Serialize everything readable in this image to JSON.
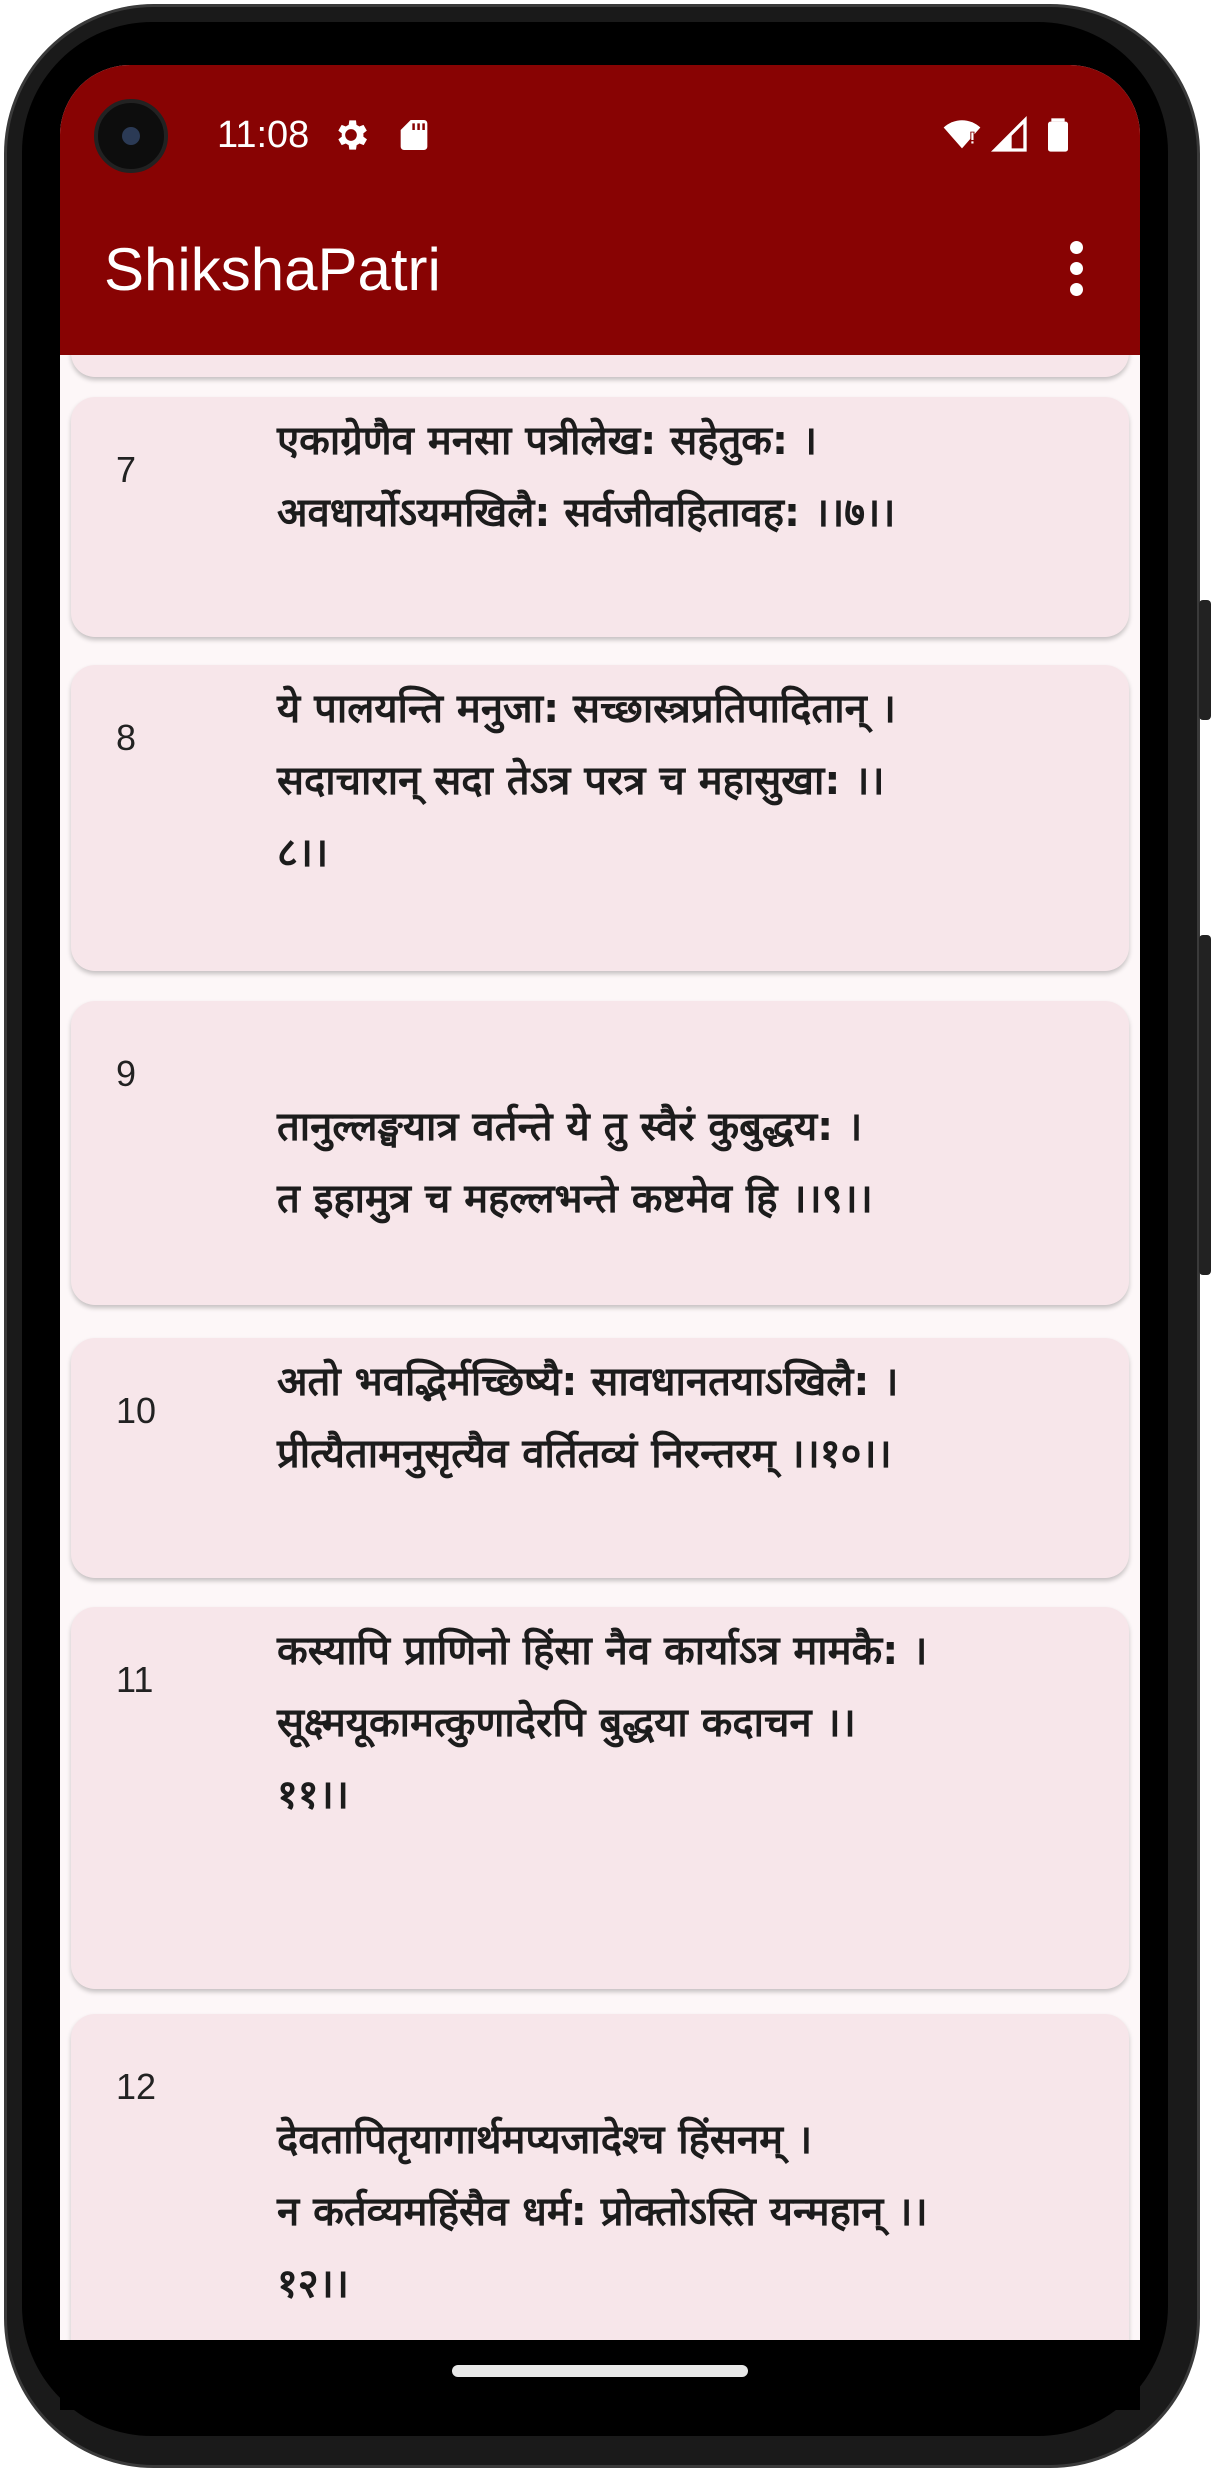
{
  "status_bar": {
    "time": "11:08",
    "icons": [
      "settings-gear-icon",
      "sd-card-icon",
      "wifi-icon",
      "signal-icon",
      "battery-icon"
    ]
  },
  "app_bar": {
    "title": "ShikshaPatri",
    "menu_icon": "more-vert-icon",
    "color": "#880303"
  },
  "colors": {
    "card_background": "#f7e6ea",
    "screen_background": "#fdf7f8"
  },
  "verses": [
    {
      "number": "7",
      "lines": [
        "एकाग्रेणैव मनसा पत्रीलेख: सहेतुक: ।",
        "अवधार्योऽयमखिलै: सर्वजीवहितावह: ।।७।।"
      ]
    },
    {
      "number": "8",
      "lines": [
        "ये पालयन्ति मनुजा: सच्छास्त्रप्रतिपादितान् ।",
        "सदाचारान् सदा तेऽत्र परत्र  च  महासुखा: ।।",
        "८।।"
      ]
    },
    {
      "number": "9",
      "lines": [
        "तानुल्लङ्घयात्र वर्तन्ते ये तु स्वैरं कुबुद्धय: ।",
        "त इहामुत्र च महल्लभन्ते कष्टमेव हि ।।९।।"
      ]
    },
    {
      "number": "10",
      "lines": [
        "अतो भवद्भिर्मच्छिष्यै: सावधानतयाऽखिलै: ।",
        "प्रीत्यैतामनुसृत्यैव वर्तितव्यं निरन्तरम् ।।१०।।"
      ]
    },
    {
      "number": "11",
      "lines": [
        "कस्यापि प्राणिनो हिंसा नैव कार्याऽत्र मामकै: ।",
        "सूक्ष्मयूकामत्कुणादेरपि बुद्धया कदाचन ।।",
        "११।।"
      ]
    },
    {
      "number": "12",
      "lines": [
        "देवतापितृयागार्थमप्यजादेश्च हिंसनम् ।",
        "न कर्तव्यमहिंसैव धर्म: प्रोक्तोऽस्ति यन्महान् ।।",
        "१२।।"
      ]
    }
  ]
}
